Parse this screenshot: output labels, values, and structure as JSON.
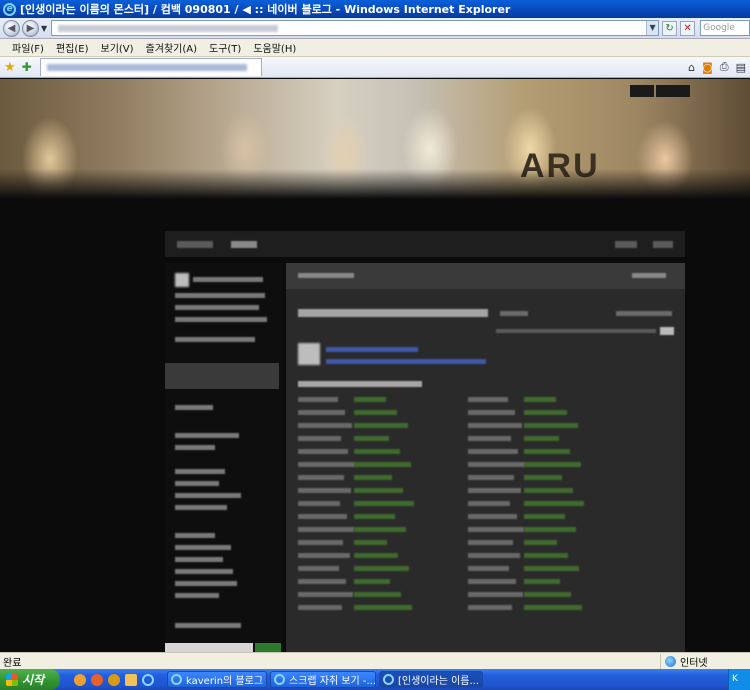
{
  "window": {
    "title": "[인생이라는 이름의 몬스터] / 컴백 090801 / ◀ :: 네이버 블로그 - Windows Internet Explorer"
  },
  "toolbar": {
    "back_glyph": "◀",
    "forward_glyph": "▶",
    "search_placeholder": "Google"
  },
  "menu": {
    "items": [
      "파일(F)",
      "편집(E)",
      "보기(V)",
      "즐겨찾기(A)",
      "도구(T)",
      "도움말(H)"
    ]
  },
  "page": {
    "banner_text": "ARU"
  },
  "status": {
    "left": "완료",
    "zone": "인터넷"
  },
  "taskbar": {
    "start_label": "시작",
    "tasks": [
      {
        "label": "kaverin의 블로그 ::..."
      },
      {
        "label": "스크랩 자취 보기 -..."
      },
      {
        "label": "[인생이라는 이름..."
      }
    ],
    "tray_text": "K"
  },
  "colors": {
    "titlebar": "#0848b8",
    "taskbar": "#245edc",
    "start": "#2f932f",
    "page_bg": "#0b0b0b"
  }
}
